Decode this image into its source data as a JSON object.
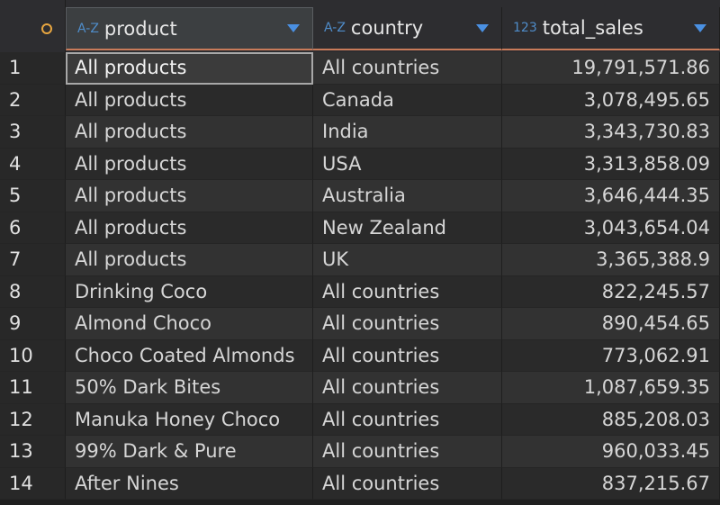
{
  "columns": {
    "product": {
      "label": "product",
      "type_icon": "A-Z"
    },
    "country": {
      "label": "country",
      "type_icon": "A-Z"
    },
    "total_sales": {
      "label": "total_sales",
      "type_icon": "123"
    }
  },
  "rows": [
    {
      "num": "1",
      "product": "All products",
      "country": "All countries",
      "total_sales": "19,791,571.86"
    },
    {
      "num": "2",
      "product": "All products",
      "country": "Canada",
      "total_sales": "3,078,495.65"
    },
    {
      "num": "3",
      "product": "All products",
      "country": "India",
      "total_sales": "3,343,730.83"
    },
    {
      "num": "4",
      "product": "All products",
      "country": "USA",
      "total_sales": "3,313,858.09"
    },
    {
      "num": "5",
      "product": "All products",
      "country": "Australia",
      "total_sales": "3,646,444.35"
    },
    {
      "num": "6",
      "product": "All products",
      "country": "New Zealand",
      "total_sales": "3,043,654.04"
    },
    {
      "num": "7",
      "product": "All products",
      "country": "UK",
      "total_sales": "3,365,388.9"
    },
    {
      "num": "8",
      "product": "Drinking Coco",
      "country": "All countries",
      "total_sales": "822,245.57"
    },
    {
      "num": "9",
      "product": "Almond Choco",
      "country": "All countries",
      "total_sales": "890,454.65"
    },
    {
      "num": "10",
      "product": "Choco Coated Almonds",
      "country": "All countries",
      "total_sales": "773,062.91"
    },
    {
      "num": "11",
      "product": "50% Dark Bites",
      "country": "All countries",
      "total_sales": "1,087,659.35"
    },
    {
      "num": "12",
      "product": "Manuka Honey Choco",
      "country": "All countries",
      "total_sales": "885,208.03"
    },
    {
      "num": "13",
      "product": "99% Dark & Pure",
      "country": "All countries",
      "total_sales": "960,033.45"
    },
    {
      "num": "14",
      "product": "After Nines",
      "country": "All countries",
      "total_sales": "837,215.67"
    }
  ],
  "colors": {
    "accent_sort": "#4a90e2",
    "type_icon": "#4f8cc9",
    "corner_circle": "#e8a640",
    "header_underline": "#c97b5a"
  }
}
